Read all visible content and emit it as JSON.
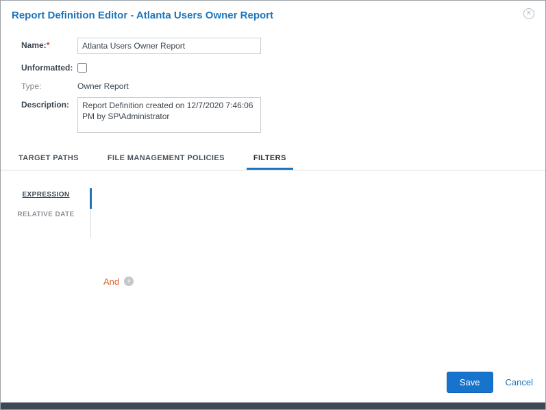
{
  "dialog": {
    "title": "Report Definition Editor - Atlanta Users Owner Report"
  },
  "form": {
    "name": {
      "label": "Name:",
      "required_mark": "*",
      "value": "Atlanta Users Owner Report"
    },
    "unformatted": {
      "label": "Unformatted:",
      "checked": false
    },
    "type": {
      "label": "Type:",
      "value": "Owner Report"
    },
    "description": {
      "label": "Description:",
      "value": "Report Definition created on 12/7/2020 7:46:06 PM by SP\\Administrator"
    }
  },
  "tabs": [
    {
      "label": "TARGET PATHS",
      "active": false
    },
    {
      "label": "FILE MANAGEMENT POLICIES",
      "active": false
    },
    {
      "label": "FILTERS",
      "active": true
    }
  ],
  "filter_nav": [
    {
      "label": "EXPRESSION",
      "active": true
    },
    {
      "label": "RELATIVE DATE",
      "active": false
    }
  ],
  "expression": {
    "operator": "And",
    "add_icon": "plus-circle-icon"
  },
  "footer": {
    "save_label": "Save",
    "cancel_label": "Cancel"
  },
  "icons": {
    "close": "circle-x-icon"
  },
  "colors": {
    "title_blue": "#1c75bc",
    "operator_orange": "#e0622a",
    "save_button_bg": "#1774cc",
    "bottom_bar": "#3c4854",
    "required_red": "#e03c31"
  }
}
